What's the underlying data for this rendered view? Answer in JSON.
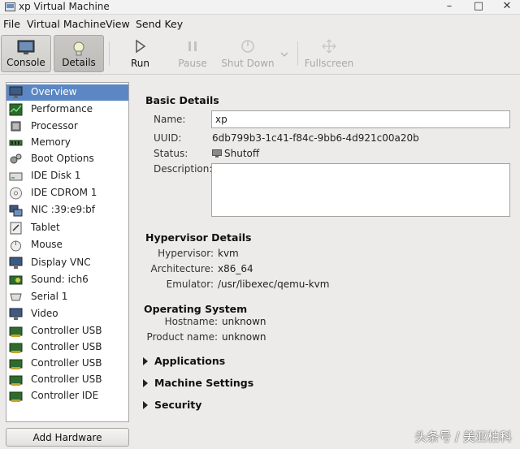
{
  "window": {
    "title": "xp Virtual Machine"
  },
  "menu": [
    "File",
    "Virtual Machine",
    "View",
    "Send Key"
  ],
  "toolbar": {
    "console": "Console",
    "details": "Details",
    "run": "Run",
    "pause": "Pause",
    "shutdown": "Shut Down",
    "fullscreen": "Fullscreen"
  },
  "sidebar": {
    "items": [
      {
        "label": "Overview",
        "icon": "monitor-icon"
      },
      {
        "label": "Performance",
        "icon": "performance-graph-icon"
      },
      {
        "label": "Processor",
        "icon": "processor-chip-icon"
      },
      {
        "label": "Memory",
        "icon": "memory-module-icon"
      },
      {
        "label": "Boot Options",
        "icon": "boot-gears-icon"
      },
      {
        "label": "IDE Disk 1",
        "icon": "disk-drive-icon"
      },
      {
        "label": "IDE CDROM 1",
        "icon": "cdrom-icon"
      },
      {
        "label": "NIC :39:e9:bf",
        "icon": "network-card-icon"
      },
      {
        "label": "Tablet",
        "icon": "tablet-icon"
      },
      {
        "label": "Mouse",
        "icon": "mouse-icon"
      },
      {
        "label": "Display VNC",
        "icon": "display-icon"
      },
      {
        "label": "Sound: ich6",
        "icon": "sound-card-icon"
      },
      {
        "label": "Serial 1",
        "icon": "serial-port-icon"
      },
      {
        "label": "Video",
        "icon": "video-card-icon"
      },
      {
        "label": "Controller USB",
        "icon": "controller-card-icon"
      },
      {
        "label": "Controller USB",
        "icon": "controller-card-icon"
      },
      {
        "label": "Controller USB",
        "icon": "controller-card-icon"
      },
      {
        "label": "Controller USB",
        "icon": "controller-card-icon"
      },
      {
        "label": "Controller IDE",
        "icon": "controller-card-icon"
      }
    ],
    "add_hardware": "Add Hardware"
  },
  "basic": {
    "heading": "Basic Details",
    "name_label": "Name:",
    "name_value": "xp",
    "uuid_label": "UUID:",
    "uuid_value": "6db799b3-1c41-f84c-9bb6-4d921c00a20b",
    "status_label": "Status:",
    "status_value": "Shutoff",
    "description_label": "Description:",
    "description_value": ""
  },
  "hypervisor": {
    "heading": "Hypervisor Details",
    "hypervisor_label": "Hypervisor:",
    "hypervisor_value": "kvm",
    "arch_label": "Architecture:",
    "arch_value": "x86_64",
    "emulator_label": "Emulator:",
    "emulator_value": "/usr/libexec/qemu-kvm"
  },
  "os": {
    "heading": "Operating System",
    "hostname_label": "Hostname:",
    "hostname_value": "unknown",
    "product_label": "Product name:",
    "product_value": "unknown"
  },
  "expanders": {
    "applications": "Applications",
    "machine_settings": "Machine Settings",
    "security": "Security"
  },
  "watermark": "头条号 / 美亚柏科",
  "colors": {
    "selection": "#5b87c4",
    "window_bg": "#ecebea"
  }
}
